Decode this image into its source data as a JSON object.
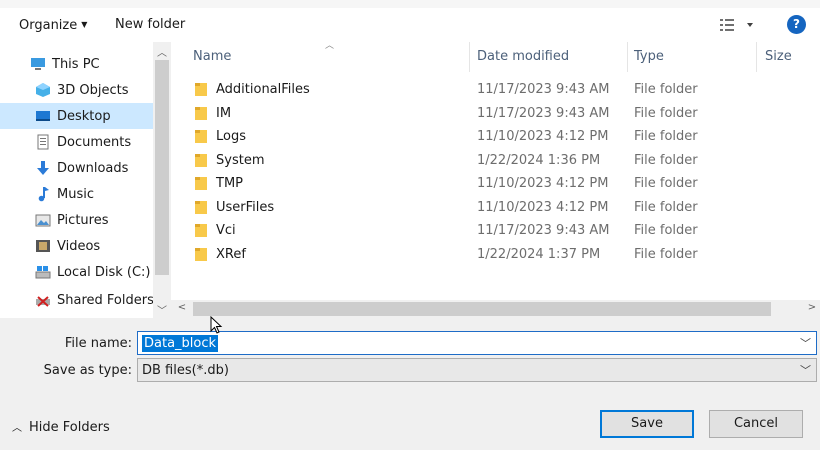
{
  "toolbar": {
    "organize_label": "Organize",
    "new_folder_label": "New folder",
    "help_label": "?"
  },
  "nav": {
    "items": [
      {
        "label": "This PC",
        "icon": "this-pc-icon",
        "indent": false,
        "selected": false
      },
      {
        "label": "3D Objects",
        "icon": "3d-objects-icon",
        "indent": true,
        "selected": false
      },
      {
        "label": "Desktop",
        "icon": "desktop-icon",
        "indent": true,
        "selected": true
      },
      {
        "label": "Documents",
        "icon": "documents-icon",
        "indent": true,
        "selected": false
      },
      {
        "label": "Downloads",
        "icon": "downloads-icon",
        "indent": true,
        "selected": false
      },
      {
        "label": "Music",
        "icon": "music-icon",
        "indent": true,
        "selected": false
      },
      {
        "label": "Pictures",
        "icon": "pictures-icon",
        "indent": true,
        "selected": false
      },
      {
        "label": "Videos",
        "icon": "videos-icon",
        "indent": true,
        "selected": false
      },
      {
        "label": "Local Disk (C:)",
        "icon": "local-disk-icon",
        "indent": true,
        "selected": false
      },
      {
        "label": "Shared Folders (\\",
        "icon": "shared-folders-icon",
        "indent": true,
        "selected": false
      }
    ]
  },
  "files": {
    "columns": {
      "name": "Name",
      "date": "Date modified",
      "type": "Type",
      "size": "Size"
    },
    "rows": [
      {
        "name": "AdditionalFiles",
        "date": "11/17/2023 9:43 AM",
        "type": "File folder"
      },
      {
        "name": "IM",
        "date": "11/17/2023 9:43 AM",
        "type": "File folder"
      },
      {
        "name": "Logs",
        "date": "11/10/2023 4:12 PM",
        "type": "File folder"
      },
      {
        "name": "System",
        "date": "1/22/2024 1:36 PM",
        "type": "File folder"
      },
      {
        "name": "TMP",
        "date": "11/10/2023 4:12 PM",
        "type": "File folder"
      },
      {
        "name": "UserFiles",
        "date": "11/10/2023 4:12 PM",
        "type": "File folder"
      },
      {
        "name": "Vci",
        "date": "11/17/2023 9:43 AM",
        "type": "File folder"
      },
      {
        "name": "XRef",
        "date": "1/22/2024 1:37 PM",
        "type": "File folder"
      }
    ]
  },
  "form": {
    "file_name_label": "File name:",
    "file_name_value": "Data_block",
    "save_as_type_label": "Save as type:",
    "save_as_type_value": "DB files(*.db)"
  },
  "footer": {
    "hide_folders_label": "Hide Folders",
    "save_label": "Save",
    "cancel_label": "Cancel"
  },
  "colors": {
    "accent": "#0078d7",
    "selection": "#cce8ff",
    "folder": "#f8c94a"
  }
}
